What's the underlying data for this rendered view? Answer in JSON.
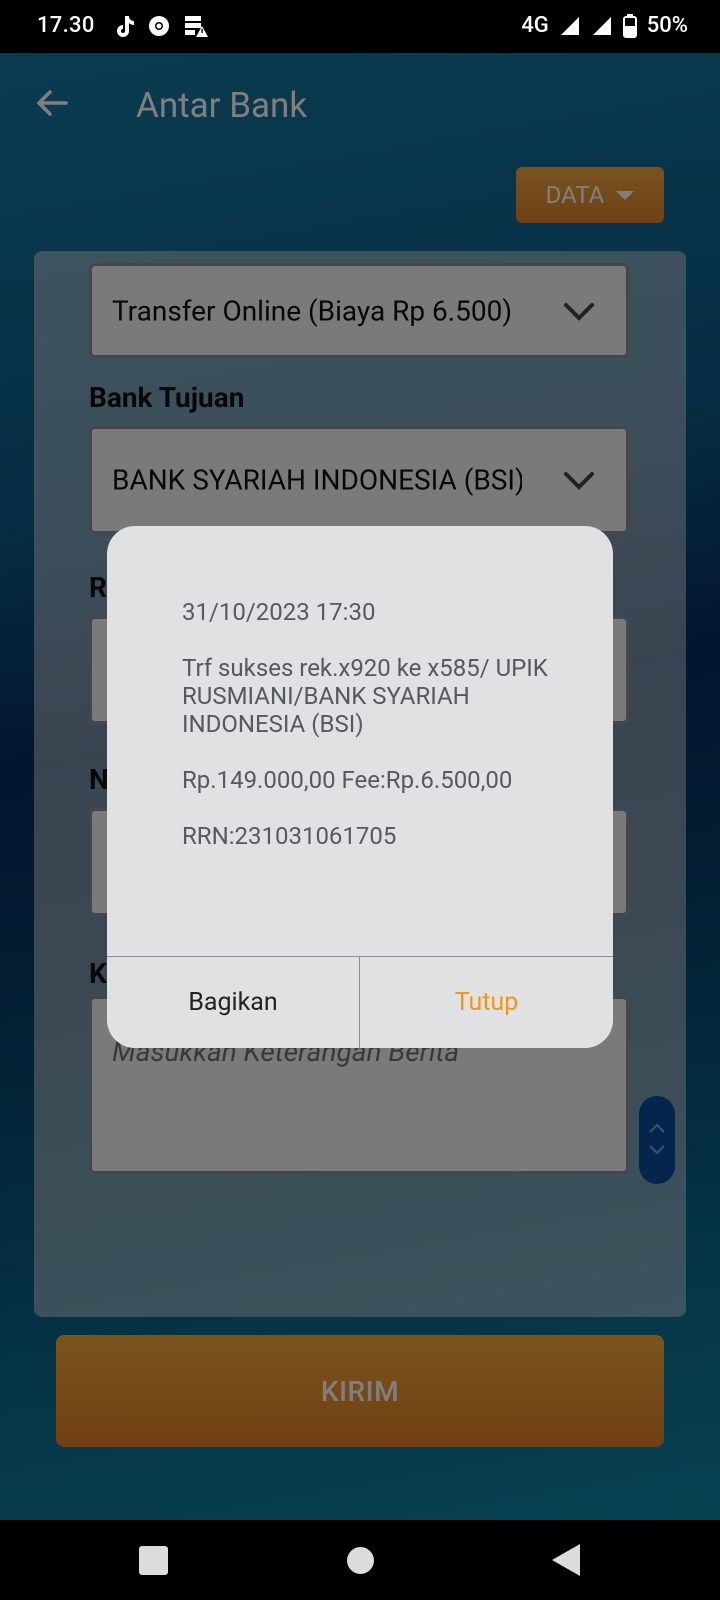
{
  "status_bar": {
    "time": "17.30",
    "network": "4G",
    "battery": "50%",
    "icons": [
      "tiktok-icon",
      "chrome-icon",
      "storage-warning-icon"
    ]
  },
  "header": {
    "title": "Antar Bank",
    "data_button": "DATA"
  },
  "form": {
    "transfer_type_value": "Transfer Online (Biaya Rp 6.500)",
    "bank_label": "Bank Tujuan",
    "bank_value": "BANK SYARIAH INDONESIA (BSI)",
    "label_r": "R",
    "label_n": "N",
    "label_k": "K",
    "note_placeholder": "Masukkan Keterangan Berita",
    "submit_label": "KIRIM"
  },
  "dialog": {
    "datetime": "31/10/2023 17:30",
    "message": "Trf sukses rek.x920 ke x585/ UPIK RUSMIANI/BANK SYARIAH INDONESIA (BSI)",
    "amount": "Rp.149.000,00 Fee:Rp.6.500,00",
    "rrn": "RRN:231031061705",
    "share_label": "Bagikan",
    "close_label": "Tutup"
  },
  "colors": {
    "accent_orange": "#f0961a",
    "button_orange": "#e88d30",
    "background_blue": "#0c5a86"
  }
}
